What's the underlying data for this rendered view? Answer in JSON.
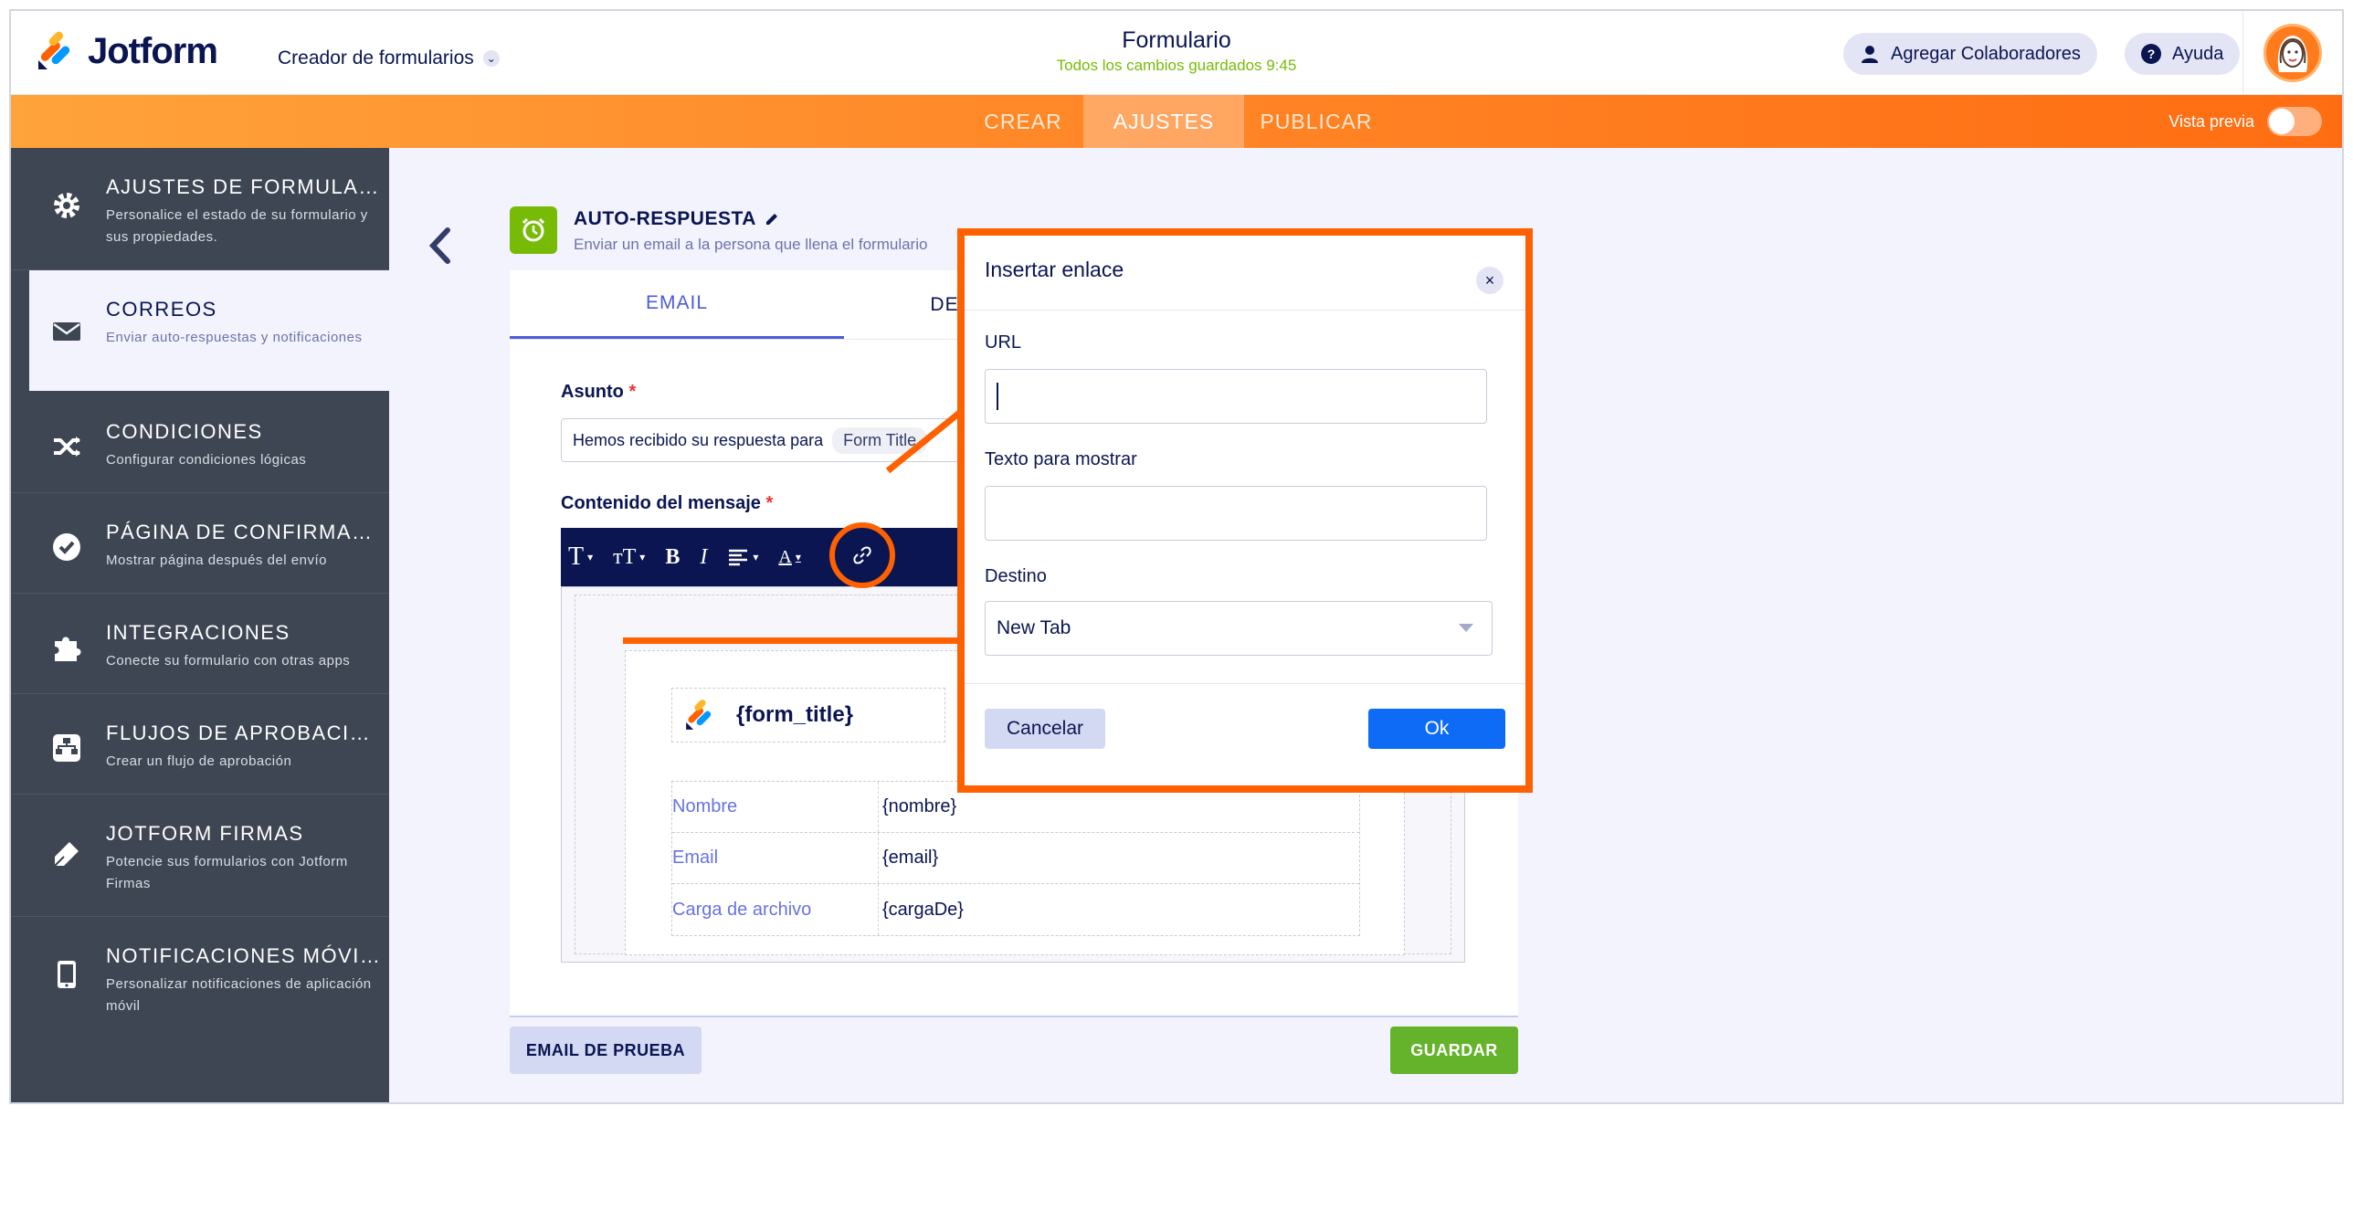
{
  "header": {
    "logo_text": "Jotform",
    "builder_menu": "Creador de formularios",
    "form_title": "Formulario",
    "save_status": "Todos los cambios guardados 9:45",
    "collaborators_label": "Agregar Colaboradores",
    "help_label": "Ayuda"
  },
  "nav": {
    "tabs": [
      {
        "label": "CREAR"
      },
      {
        "label": "AJUSTES"
      },
      {
        "label": "PUBLICAR"
      }
    ],
    "active_tab": "AJUSTES",
    "preview_label": "Vista previa",
    "preview_on": false
  },
  "sidebar": {
    "items": [
      {
        "title": "AJUSTES DE FORMULARIO",
        "desc": "Personalice el estado de su formulario y sus propiedades.",
        "icon": "gear-icon"
      },
      {
        "title": "CORREOS",
        "desc": "Enviar auto-respuestas y notificaciones",
        "icon": "envelope-icon"
      },
      {
        "title": "CONDICIONES",
        "desc": "Configurar condiciones lógicas",
        "icon": "shuffle-icon"
      },
      {
        "title": "PÁGINA DE CONFIRMACI...",
        "desc": "Mostrar página después del envío",
        "icon": "check-circle-icon"
      },
      {
        "title": "INTEGRACIONES",
        "desc": "Conecte su formulario con otras apps",
        "icon": "puzzle-icon"
      },
      {
        "title": "FLUJOS DE APROBACIÓN",
        "desc": "Crear un flujo de aprobación",
        "icon": "workflow-icon"
      },
      {
        "title": "JOTFORM FIRMAS",
        "desc": "Potencie sus formularios con Jotform Firmas",
        "icon": "pen-icon"
      },
      {
        "title": "NOTIFICACIONES MÓVIL...",
        "desc": "Personalizar notificaciones de aplicación móvil",
        "icon": "mobile-icon"
      }
    ],
    "active_item": "CORREOS"
  },
  "autoresponse": {
    "title": "AUTO-RESPUESTA",
    "subtitle": "Enviar un email a la persona que llena el formulario",
    "tabs": [
      {
        "label": "EMAIL"
      },
      {
        "label": "DE"
      }
    ],
    "subject_label": "Asunto",
    "subject_text": "Hemos recibido su respuesta para",
    "subject_tag": "Form Title",
    "content_label": "Contenido del mensaje",
    "required_mark": "*",
    "card_title": "{form_title}",
    "rows": [
      {
        "label": "Nombre",
        "value": "{nombre}"
      },
      {
        "label": "Email",
        "value": "{email}"
      },
      {
        "label": "Carga de archivo",
        "value": "{cargaDe}"
      }
    ],
    "test_button": "EMAIL DE PRUEBA",
    "save_button": "GUARDAR"
  },
  "toolbar": {
    "font": "T",
    "size": "тT",
    "bold": "B",
    "italic": "I",
    "color": "A"
  },
  "dialog": {
    "title": "Insertar enlace",
    "close": "×",
    "url_label": "URL",
    "url_value": "",
    "text_label": "Texto para mostrar",
    "text_value": "",
    "target_label": "Destino",
    "target_value": "New Tab",
    "cancel": "Cancelar",
    "ok": "Ok"
  },
  "colors": {
    "brand_navy": "#0a1551",
    "accent_orange": "#ff6100",
    "sidebar_bg": "#3e4653",
    "ok_blue": "#0d6bf5",
    "save_green": "#64b32b"
  }
}
